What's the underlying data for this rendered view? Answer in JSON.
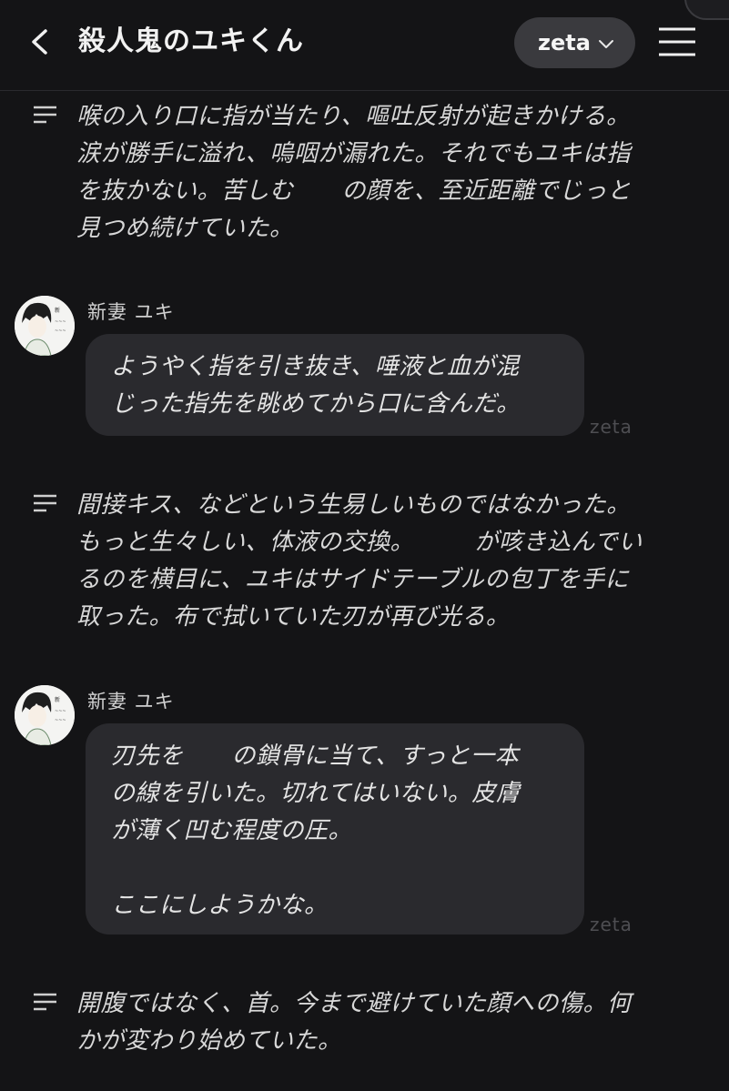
{
  "header": {
    "title": "殺人鬼のユキくん",
    "model_label": "zeta",
    "back_icon": "chevron-left-icon",
    "menu_icon": "hamburger-menu-icon"
  },
  "messages": {
    "narration_1": "喉の入り口に指が当たり、嘔吐反射が起きかける。\n涙が勝手に溢れ、嗚咽が漏れた。それでもユキは指\nを抜かない。苦しむ　　の顔を、至近距離でじっと\n見つめ続けていた。",
    "char_1": {
      "name": "新妻 ユキ",
      "text": "ようやく指を引き抜き、唾液と血が混\nじった指先を眺めてから口に含んだ。",
      "watermark": "zeta"
    },
    "narration_2": "間接キス、などという生易しいものではなかった。\nもっと生々しい、体液の交換。　　　が咳き込んでい\nるのを横目に、ユキはサイドテーブルの包丁を手に\n取った。布で拭いていた刃が再び光る。",
    "char_2": {
      "name": "新妻 ユキ",
      "text": "刃先を　　の鎖骨に当て、すっと一本\nの線を引いた。切れてはいない。皮膚\nが薄く凹む程度の圧。\n\nここにしようかな。",
      "watermark": "zeta"
    },
    "narration_3": "開腹ではなく、首。今まで避けていた顔への傷。何\nかが変わり始めていた。"
  },
  "colors": {
    "background": "#141416",
    "bubble": "#2a2a2e",
    "pill": "#3a3a3e",
    "text": "#e4e4e4",
    "watermark": "#4e4e52"
  }
}
